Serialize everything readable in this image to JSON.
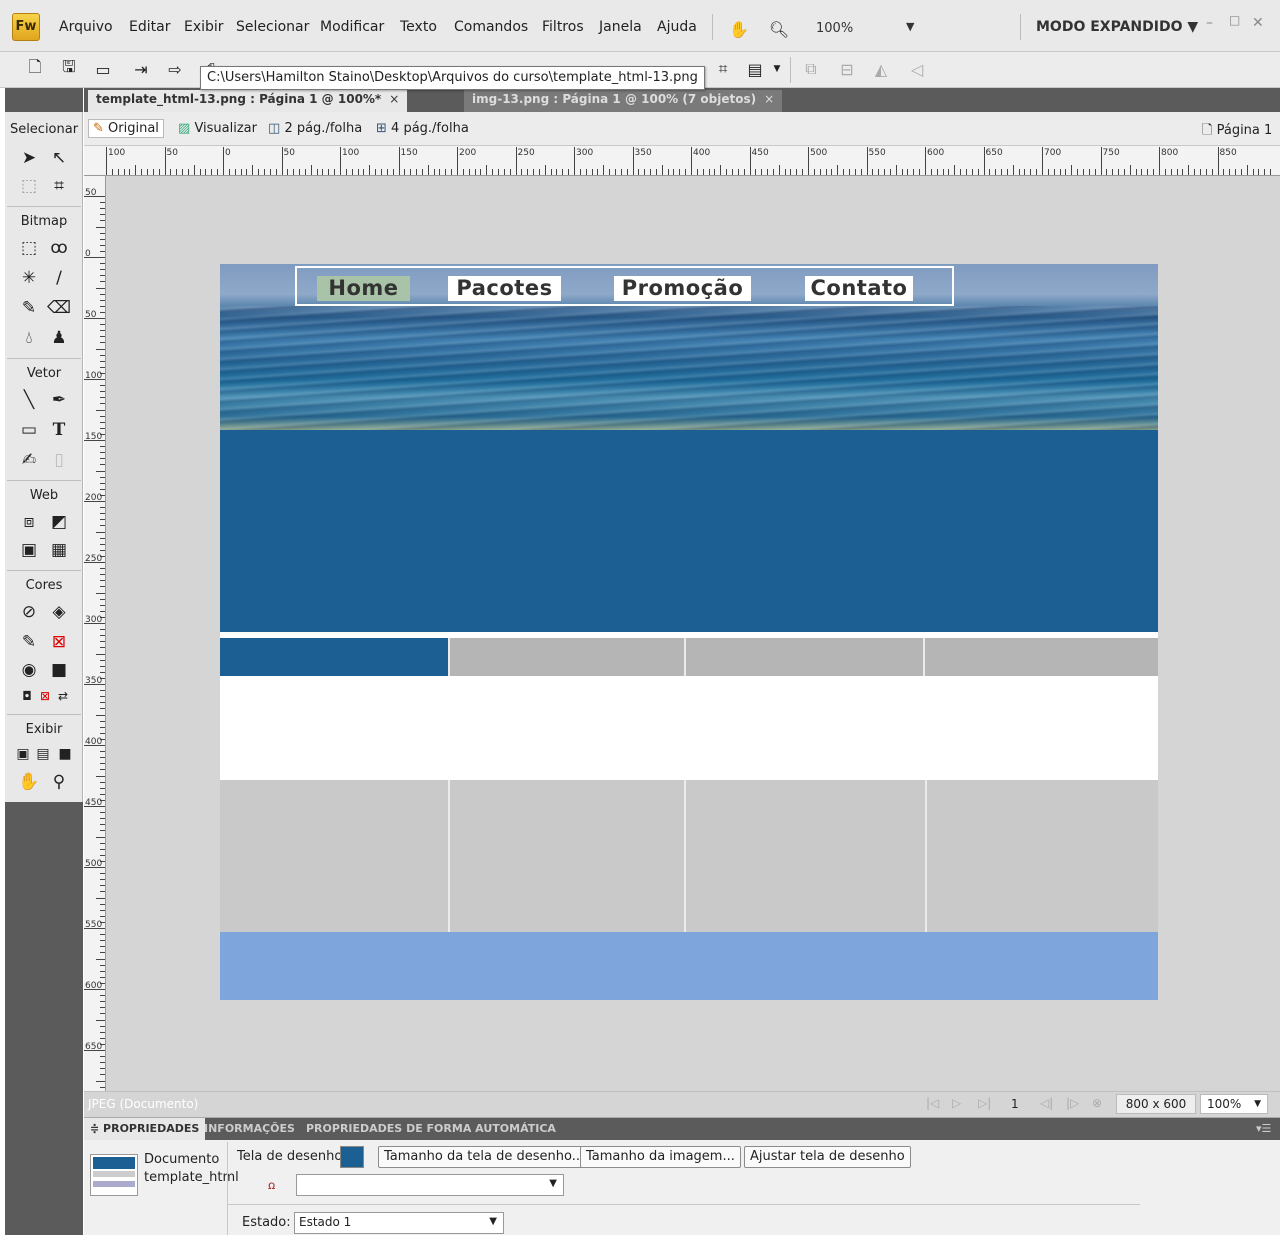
{
  "app": {
    "logo": "Fw"
  },
  "menu": [
    "Arquivo",
    "Editar",
    "Exibir",
    "Selecionar",
    "Modificar",
    "Texto",
    "Comandos",
    "Filtros",
    "Janela",
    "Ajuda"
  ],
  "menubar": {
    "zoom": "100%",
    "mode": "MODO EXPANDIDO ▼",
    "minimize": "–",
    "maximize": "□",
    "close": "✕"
  },
  "tooltip": "C:\\Users\\Hamilton Staino\\Desktop\\Arquivos do curso\\template_html-13.png",
  "doc_tabs": [
    {
      "label": "template_html-13.png : Página 1 @ 100%*",
      "close": "×"
    },
    {
      "label": "img-13.png : Página 1 @ 100% (7 objetos)",
      "close": "×"
    }
  ],
  "tools_panel": {
    "selecionar": "Selecionar",
    "bitmap": "Bitmap",
    "vetor": "Vetor",
    "web": "Web",
    "cores": "Cores",
    "exibir": "Exibir"
  },
  "viewbar": {
    "original": "Original",
    "visualizar": "Visualizar",
    "two_up": "2 pág./folha",
    "four_up": "4 pág./folha",
    "page": "Página 1"
  },
  "ruler_top": [
    "100",
    "50",
    "0",
    "50",
    "100",
    "150",
    "200",
    "250",
    "300",
    "350",
    "400",
    "450",
    "500",
    "550",
    "600",
    "650",
    "700",
    "750",
    "800",
    "850"
  ],
  "ruler_left": [
    "50",
    "0",
    "50",
    "100",
    "150",
    "200",
    "250",
    "300",
    "350",
    "400",
    "450",
    "500",
    "550",
    "600",
    "650"
  ],
  "canvas": {
    "nav": [
      "Home",
      "Pacotes",
      "Promoção",
      "Contato"
    ],
    "colors": {
      "header_blue": "#1c5f93",
      "tab_grey": "#b5b5b5",
      "column_grey": "#c9c9c9",
      "footer_blue": "#7fa6dc",
      "home_highlight": "#a9c3a9"
    }
  },
  "statusbar": {
    "type": "JPEG (Documento)",
    "frame": "1",
    "size": "800 x 600",
    "zoom": "100%"
  },
  "properties": {
    "tabs": [
      "≑ PROPRIEDADES",
      "INFORMAÇÕES",
      "PROPRIEDADES DE FORMA AUTOMÁTICA"
    ],
    "doc_label": "Documento",
    "doc_name": "template_html",
    "canvas_label": "Tela de desenho:",
    "canvas_size_btn": "Tamanho da tela de desenho...",
    "image_size_btn": "Tamanho da imagem...",
    "fit_canvas_btn": "Ajustar tela de desenho",
    "state_label": "Estado:",
    "state_value": "Estado 1"
  }
}
